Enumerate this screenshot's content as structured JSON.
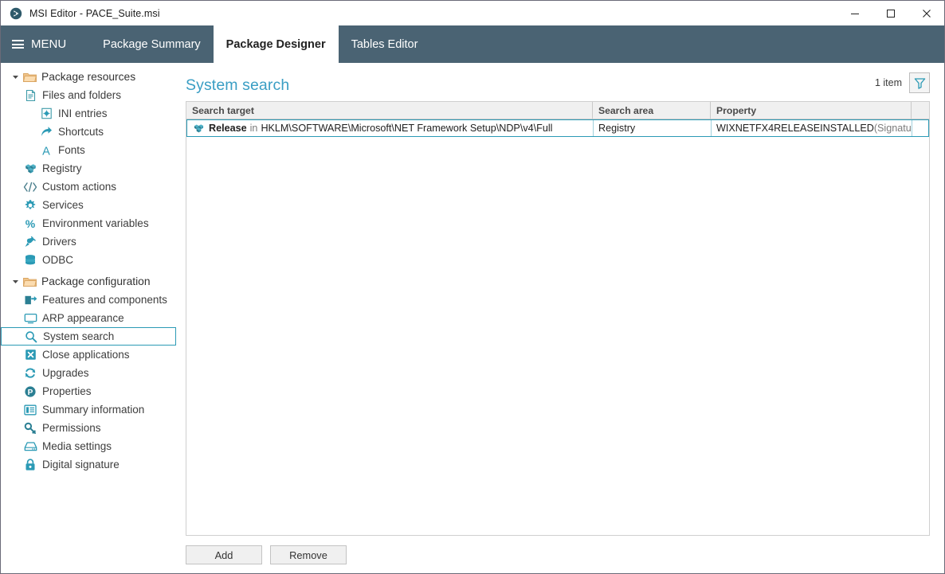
{
  "window": {
    "title": "MSI Editor - PACE_Suite.msi",
    "app_icon": "msi-editor-logo-icon",
    "controls": {
      "minimize": "minimize-icon",
      "maximize": "maximize-icon",
      "close": "close-icon"
    }
  },
  "tabbar": {
    "menu_label": "MENU",
    "tabs": [
      {
        "label": "Package Summary",
        "active": false
      },
      {
        "label": "Package Designer",
        "active": true
      },
      {
        "label": "Tables Editor",
        "active": false
      }
    ]
  },
  "sidebar": {
    "groups": [
      {
        "label": "Package resources",
        "icon": "folder-icon",
        "expanded": true,
        "items": [
          {
            "label": "Files and folders",
            "icon": "file-icon",
            "indent": 1,
            "selected": false
          },
          {
            "label": "INI entries",
            "icon": "ini-file-icon",
            "indent": 2,
            "selected": false
          },
          {
            "label": "Shortcuts",
            "icon": "shortcut-arrow-icon",
            "indent": 2,
            "selected": false
          },
          {
            "label": "Fonts",
            "icon": "font-letter-a-icon",
            "indent": 2,
            "selected": false
          },
          {
            "label": "Registry",
            "icon": "registry-blocks-icon",
            "indent": 1,
            "selected": false
          },
          {
            "label": "Custom actions",
            "icon": "code-brackets-icon",
            "indent": 1,
            "selected": false
          },
          {
            "label": "Services",
            "icon": "gear-icon",
            "indent": 1,
            "selected": false
          },
          {
            "label": "Environment variables",
            "icon": "percent-icon",
            "indent": 1,
            "selected": false
          },
          {
            "label": "Drivers",
            "icon": "plug-icon",
            "indent": 1,
            "selected": false
          },
          {
            "label": "ODBC",
            "icon": "database-icon",
            "indent": 1,
            "selected": false
          }
        ]
      },
      {
        "label": "Package configuration",
        "icon": "folder-icon",
        "expanded": true,
        "items": [
          {
            "label": "Features and components",
            "icon": "puzzle-feature-icon",
            "indent": 1,
            "selected": false
          },
          {
            "label": "ARP appearance",
            "icon": "monitor-icon",
            "indent": 1,
            "selected": false
          },
          {
            "label": "System search",
            "icon": "search-icon",
            "indent": 1,
            "selected": true
          },
          {
            "label": "Close applications",
            "icon": "close-x-box-icon",
            "indent": 1,
            "selected": false
          },
          {
            "label": "Upgrades",
            "icon": "refresh-arrows-icon",
            "indent": 1,
            "selected": false
          },
          {
            "label": "Properties",
            "icon": "circle-p-icon",
            "indent": 1,
            "selected": false
          },
          {
            "label": "Summary information",
            "icon": "list-panel-icon",
            "indent": 1,
            "selected": false
          },
          {
            "label": "Permissions",
            "icon": "key-icon",
            "indent": 1,
            "selected": false
          },
          {
            "label": "Media settings",
            "icon": "disk-drive-icon",
            "indent": 1,
            "selected": false
          },
          {
            "label": "Digital signature",
            "icon": "lock-icon",
            "indent": 1,
            "selected": false
          }
        ]
      }
    ]
  },
  "main": {
    "page_title": "System search",
    "item_count": "1 item",
    "filter_icon": "funnel-filter-icon",
    "table": {
      "columns": [
        "Search target",
        "Search area",
        "Property",
        ""
      ],
      "rows": [
        {
          "icon": "registry-blocks-icon",
          "target_name": "Release",
          "target_join": "in",
          "target_path": "HKLM\\SOFTWARE\\Microsoft\\NET Framework Setup\\NDP\\v4\\Full",
          "search_area": "Registry",
          "property": "WIXNETFX4RELEASEINSTALLED",
          "property_note": "(Signature: N",
          "selected": true
        }
      ]
    },
    "buttons": {
      "add": "Add",
      "remove": "Remove"
    }
  },
  "colors": {
    "tabbar_bg": "#4a6373",
    "accent_teal": "#2b9ab5",
    "title_heading": "#3a9ec4",
    "folder_icon": "#e8b87a"
  }
}
